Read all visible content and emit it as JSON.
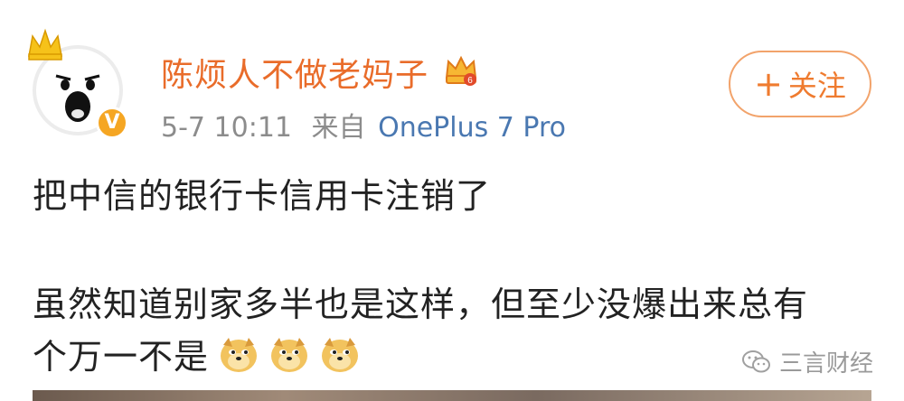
{
  "user": {
    "name": "陈烦人不做老妈子",
    "verified_badge": "V",
    "avatar_icon": "shouting-face-avatar",
    "crown_icon": "crown-icon",
    "vip_icon": "vip-crown-icon"
  },
  "meta": {
    "time": "5-7 10:11",
    "from_label": "来自",
    "device": "OnePlus 7 Pro"
  },
  "follow_button": {
    "plus": "+",
    "label": "关注"
  },
  "post": {
    "line1": "把中信的银行卡信用卡注销了",
    "line2": "虽然知道别家多半也是这样，但至少没爆出来总有",
    "line3": "个万一不是"
  },
  "emojis": [
    "doge-emoji",
    "doge-emoji",
    "doge-emoji"
  ],
  "watermark": {
    "text": "三言财经",
    "icon": "wechat-icon"
  },
  "colors": {
    "username": "#e96c2a",
    "device": "#4a78b1",
    "follow_border": "#f2a36b",
    "verified": "#f5a623"
  }
}
